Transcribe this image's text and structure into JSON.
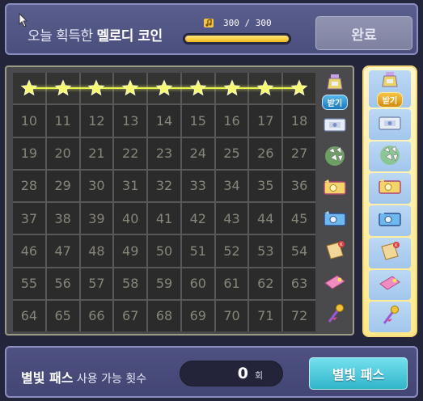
{
  "header": {
    "title_prefix": "오늘 획득한 ",
    "title_highlight": "멜로디 코인",
    "progress_text": "300 / 300",
    "progress_fraction": 1.0,
    "complete_button": "완료"
  },
  "board": {
    "rows": [
      [
        "★",
        "★",
        "★",
        "★",
        "★",
        "★",
        "★",
        "★",
        "★"
      ],
      [
        "10",
        "11",
        "12",
        "13",
        "14",
        "15",
        "16",
        "17",
        "18"
      ],
      [
        "19",
        "20",
        "21",
        "22",
        "23",
        "24",
        "25",
        "26",
        "27"
      ],
      [
        "28",
        "29",
        "30",
        "31",
        "32",
        "33",
        "34",
        "35",
        "36"
      ],
      [
        "37",
        "38",
        "39",
        "40",
        "41",
        "42",
        "43",
        "44",
        "45"
      ],
      [
        "46",
        "47",
        "48",
        "49",
        "50",
        "51",
        "52",
        "53",
        "54"
      ],
      [
        "55",
        "56",
        "57",
        "58",
        "59",
        "60",
        "61",
        "62",
        "63"
      ],
      [
        "64",
        "65",
        "66",
        "67",
        "68",
        "69",
        "70",
        "71",
        "72"
      ]
    ],
    "row_rewards": [
      {
        "icon": "potion-bottle-icon",
        "claim": "받기"
      },
      {
        "icon": "ticket-icon"
      },
      {
        "icon": "crystal-cluster-icon"
      },
      {
        "icon": "gold-ticket-icon"
      },
      {
        "icon": "blue-ticket-icon"
      },
      {
        "icon": "scroll-icon"
      },
      {
        "icon": "pink-card-icon"
      },
      {
        "icon": "magic-wand-icon"
      }
    ]
  },
  "right_column": {
    "items": [
      {
        "icon": "potion-bottle-icon",
        "claim": "받기"
      },
      {
        "icon": "ticket-icon"
      },
      {
        "icon": "crystal-cluster-icon"
      },
      {
        "icon": "gold-ticket-icon"
      },
      {
        "icon": "blue-ticket-icon"
      },
      {
        "icon": "scroll-icon"
      },
      {
        "icon": "pink-card-icon"
      },
      {
        "icon": "magic-wand-icon"
      }
    ]
  },
  "footer": {
    "pass_label": "별빛 패스",
    "pass_sub": " 사용 가능 횟수",
    "count_value": "0",
    "count_unit": "회",
    "starpass_button": "별빛 패스"
  },
  "colors": {
    "accent_yellow": "#f1b91d",
    "star_yellow": "#f3f66a",
    "button_cyan": "#31b5c9"
  }
}
